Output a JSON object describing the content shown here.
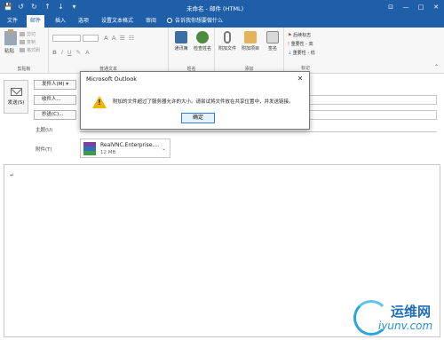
{
  "window": {
    "title": "未命名 - 邮件 (HTML)",
    "controls": [
      "⊡",
      "—",
      "□",
      "✕"
    ]
  },
  "qat": [
    "💾",
    "↺",
    "↻",
    "↑",
    "↓",
    "▾"
  ],
  "tabs": [
    {
      "label": "文件",
      "active": false
    },
    {
      "label": "邮件",
      "active": true
    },
    {
      "label": "插入",
      "active": false
    },
    {
      "label": "选项",
      "active": false
    },
    {
      "label": "设置文本格式",
      "active": false
    },
    {
      "label": "审阅",
      "active": false
    }
  ],
  "tell_me": "告诉我你想要做什么",
  "ribbon": {
    "clipboard": {
      "paste": "粘贴",
      "cut": "剪切",
      "copy": "复制",
      "format_painter": "格式刷",
      "group_label": "剪贴板"
    },
    "basic_text": {
      "group_label": "普通文本"
    },
    "names": {
      "address_book": "通讯簿",
      "check_names": "检查姓名",
      "group_label": "姓名"
    },
    "include": {
      "attach_file": "附加文件",
      "attach_item": "附加项目",
      "signature": "签名",
      "group_label": "添加"
    },
    "tags": {
      "follow_up": "后续标志",
      "high_importance": "重要性 - 高",
      "low_importance": "重要性 - 低",
      "group_label": "标记"
    }
  },
  "compose": {
    "send": "发送(S)",
    "from_btn": "发件人(M) ▾",
    "to_btn": "收件人...",
    "cc_btn": "抄送(C)...",
    "subject_label": "主题(U)",
    "attached_label": "附件(T)",
    "attachment": {
      "name": "RealVNC.Enterprise....",
      "size": "12 MB"
    },
    "body_mark": "↵"
  },
  "dialog": {
    "title": "Microsoft Outlook",
    "close": "✕",
    "message": "附加的文件超过了服务器允许的大小。请尝试将文件放在共享位置中，并发送链接。",
    "ok": "确定"
  },
  "watermark": {
    "cn": "运维网",
    "en": "iyunv.com"
  },
  "colors": {
    "titlebar": "#1e5fa8",
    "warning": "#f0b400",
    "accent_button": "#3a7bd5"
  }
}
